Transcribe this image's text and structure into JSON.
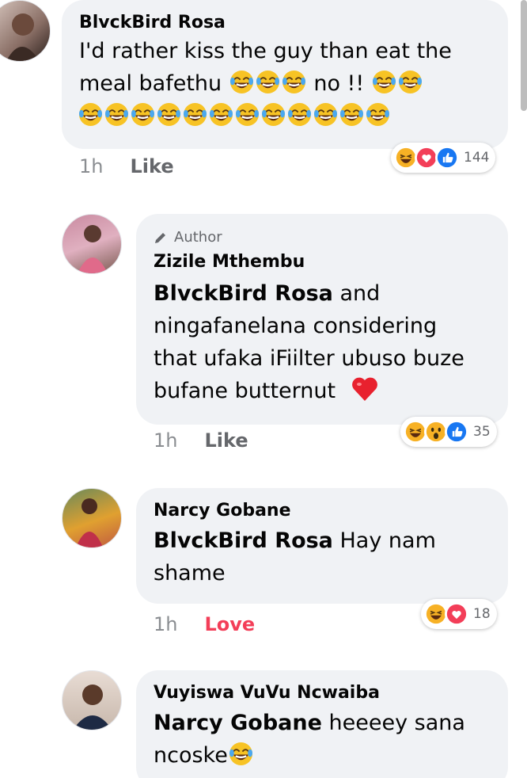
{
  "comments": [
    {
      "name": "BlvckBird Rosa",
      "line1": "I'd rather kiss the guy than eat the",
      "line2_text": "meal bafethu",
      "line2_after": "no !!",
      "time": "1h",
      "action": "Like",
      "reaction_count": "144",
      "reactions": [
        "haha",
        "love",
        "like"
      ]
    },
    {
      "author_badge": "Author",
      "name": "Zizile Mthembu",
      "mention": "BlvckBird Rosa",
      "lines": [
        "and",
        "ningafanelana considering",
        "that ufaka iFiilter ubuso buze",
        "bufane butternut"
      ],
      "time": "1h",
      "action": "Like",
      "reaction_count": "35",
      "reactions": [
        "haha",
        "wow",
        "like"
      ]
    },
    {
      "name": "Narcy Gobane",
      "mention": "BlvckBird Rosa",
      "lines": [
        "Hay nam",
        "shame"
      ],
      "time": "1h",
      "action": "Love",
      "reaction_count": "18",
      "reactions": [
        "haha",
        "love"
      ]
    },
    {
      "name": "Vuyiswa VuVu Ncwaiba",
      "mention": "Narcy Gobane",
      "lines": [
        "heeeey sana",
        "ncoske"
      ]
    }
  ],
  "colors": {
    "bubble": "#f0f2f5",
    "love_text": "#f33e58",
    "like_blue": "#1877f2",
    "haha_yellow": "#f7b125"
  },
  "icons": [
    "laughing-tears-emoji",
    "red-heart-emoji",
    "pencil-icon",
    "haha-reaction",
    "love-reaction",
    "like-reaction",
    "wow-reaction"
  ]
}
